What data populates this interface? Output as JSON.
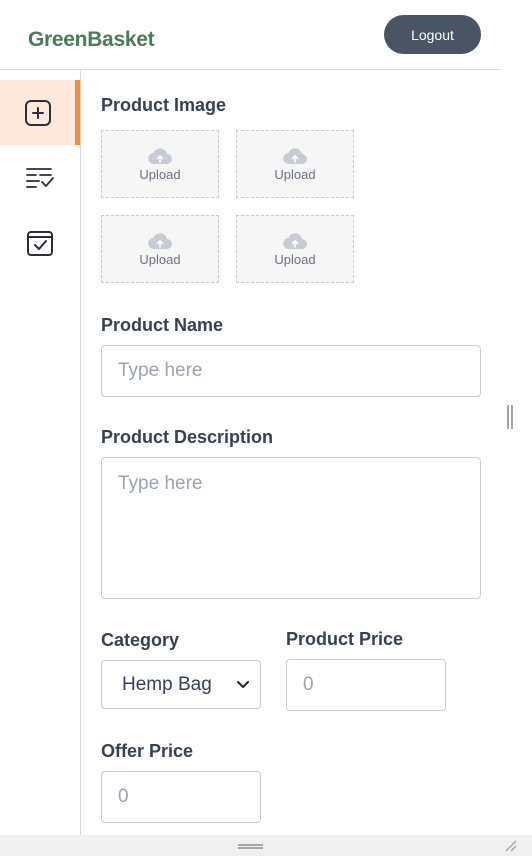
{
  "header": {
    "brand": "GreenBasket",
    "logout_label": "Logout"
  },
  "sidebar": {
    "items": [
      {
        "name": "add-product",
        "icon": "add-square-icon",
        "active": true
      },
      {
        "name": "product-list",
        "icon": "list-check-icon",
        "active": false
      },
      {
        "name": "orders",
        "icon": "calendar-check-icon",
        "active": false
      }
    ],
    "accent_color": "#f58a3d",
    "active_bg": "#fde8dc"
  },
  "form": {
    "product_image_label": "Product Image",
    "uploads": [
      "Upload",
      "Upload",
      "Upload",
      "Upload"
    ],
    "product_name_label": "Product Name",
    "product_name_placeholder": "Type here",
    "product_description_label": "Product Description",
    "product_description_placeholder": "Type here",
    "category_label": "Category",
    "category_value": "Hemp Bag",
    "product_price_label": "Product Price",
    "product_price_placeholder": "0",
    "offer_price_label": "Offer Price",
    "offer_price_placeholder": "0"
  },
  "colors": {
    "brand": "#4a7c59",
    "logout_bg": "#495464"
  }
}
